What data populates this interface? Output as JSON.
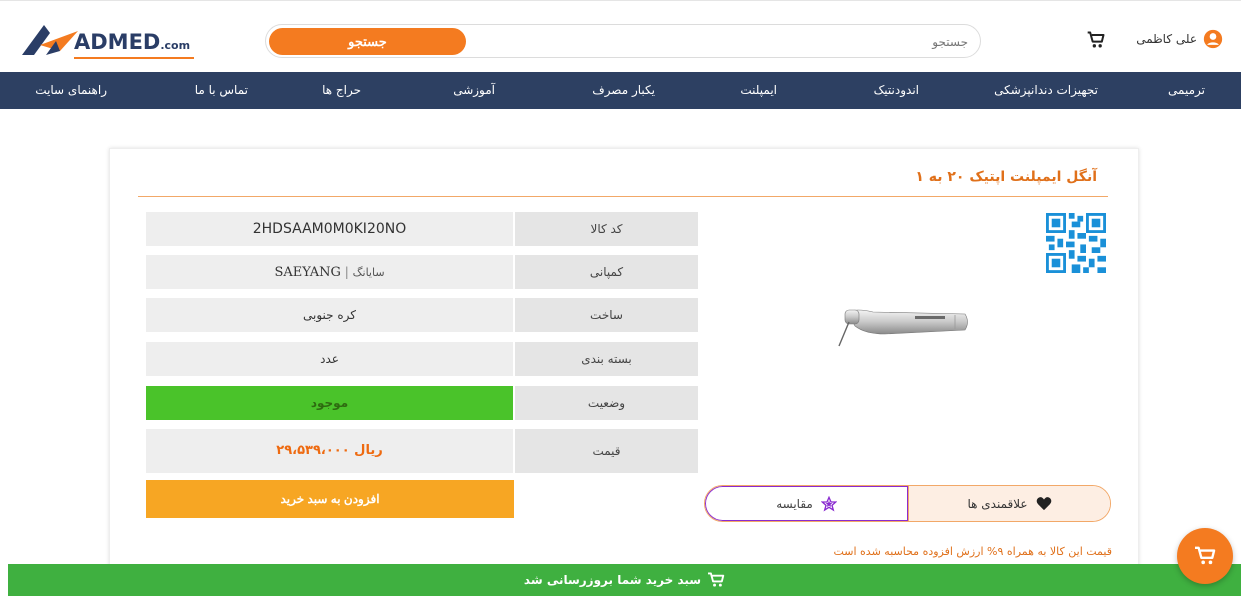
{
  "header": {
    "logo_text": "ADMED",
    "logo_suffix": ".com",
    "search": {
      "button_label": "جستجو",
      "placeholder": "جستجو"
    },
    "user": {
      "name": "علی کاظمی"
    }
  },
  "nav": {
    "items": [
      {
        "label": "ترمیمی"
      },
      {
        "label": "تجهیزات دندانپزشکی"
      },
      {
        "label": "اندودنتیک"
      },
      {
        "label": "ایمپلنت"
      },
      {
        "label": "یکبار مصرف"
      },
      {
        "label": "آموزشی"
      },
      {
        "label": "حراج ها"
      },
      {
        "label": "تماس با ما"
      },
      {
        "label": "راهنمای سایت"
      }
    ]
  },
  "product": {
    "title": "آنگل ایمپلنت اپتیک ۲۰ به ۱",
    "specs": [
      {
        "label": "کد کالا",
        "value": "2HDSAAM0M0KI20NO"
      },
      {
        "label": "کمپانی",
        "value_fa": "سایانگ",
        "value_en": "SAEYANG"
      },
      {
        "label": "ساخت",
        "value": "کره جنوبی"
      },
      {
        "label": "بسته بندی",
        "value": "عدد"
      },
      {
        "label": "وضعیت",
        "value": "موجود"
      },
      {
        "label": "قیمت",
        "value": "۲۹،۵۳۹،۰۰۰ ریال"
      }
    ],
    "add_to_cart_label": "افزودن به سبد خرید",
    "compare_label": "مقایسه",
    "favorites_label": "علاقمندی ها",
    "vat_note": "قیمت این کالا به همراه ۹% ارزش افزوده محاسبه شده است"
  },
  "bottom_bar": {
    "message": "سبد خرید شما بروزرسانی شد"
  },
  "colors": {
    "accent": "#f47b20",
    "nav_bg": "#2d4062",
    "status_green": "#4ac32a",
    "bar_green": "#3fb040",
    "compare_purple": "#8a2bd0"
  },
  "icons": [
    "cart-icon",
    "user-icon",
    "star-icon",
    "heart-icon",
    "qr-code-icon",
    "logo-icon"
  ]
}
